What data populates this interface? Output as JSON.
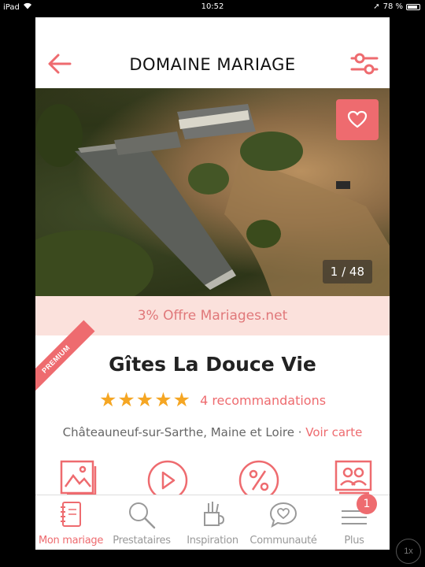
{
  "status": {
    "device": "iPad",
    "time": "10:52",
    "battery": "78 %"
  },
  "header": {
    "title": "DOMAINE MARIAGE"
  },
  "hero": {
    "counter": "1 / 48"
  },
  "offer": {
    "text": "3% Offre Mariages.net"
  },
  "vendor": {
    "badge": "PREMIUM",
    "name": "Gîtes La Douce Vie",
    "stars": 5,
    "recommendations": "4 recommandations",
    "location": "Châteauneuf-sur-Sarthe, Maine et Loire · ",
    "map_link": "Voir carte"
  },
  "tabs": [
    {
      "label": "Mon mariage",
      "icon": "notebook-icon",
      "active": true
    },
    {
      "label": "Prestataires",
      "icon": "search-icon",
      "active": false
    },
    {
      "label": "Inspiration",
      "icon": "inspiration-icon",
      "active": false
    },
    {
      "label": "Communauté",
      "icon": "chat-heart-icon",
      "active": false
    },
    {
      "label": "Plus",
      "icon": "menu-icon",
      "active": false,
      "badge": "1"
    }
  ],
  "colors": {
    "accent": "#ee6b6f",
    "offer_bg": "#fbe1dc",
    "star": "#f5a623"
  },
  "speed_indicator": "1x"
}
